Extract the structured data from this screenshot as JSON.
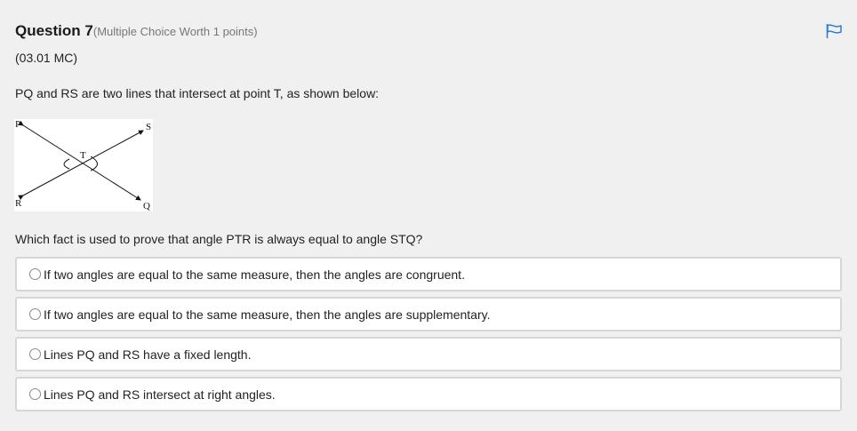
{
  "question": {
    "title": "Question 7",
    "subtitle": "(Multiple Choice Worth 1 points)",
    "code": "(03.01 MC)",
    "stem": "PQ and RS are two lines that intersect at point T, as shown below:",
    "prompt": "Which fact is used to prove that angle PTR is always equal to angle STQ?"
  },
  "figure": {
    "labels": {
      "P": "P",
      "S": "S",
      "T": "T",
      "R": "R",
      "Q": "Q"
    }
  },
  "options": [
    {
      "label": "If two angles are equal to the same measure, then the angles are congruent.",
      "selected": false
    },
    {
      "label": "If two angles are equal to the same measure, then the angles are supplementary.",
      "selected": false
    },
    {
      "label": "Lines PQ and RS have a fixed length.",
      "selected": false
    },
    {
      "label": "Lines PQ and RS intersect at right angles.",
      "selected": false
    }
  ],
  "colors": {
    "background": "#f0f0f0",
    "option_border": "#d6d6d6",
    "flag": "#2a7fd4"
  },
  "icons": {
    "flag": "flag-icon",
    "radio": "radio-icon"
  }
}
